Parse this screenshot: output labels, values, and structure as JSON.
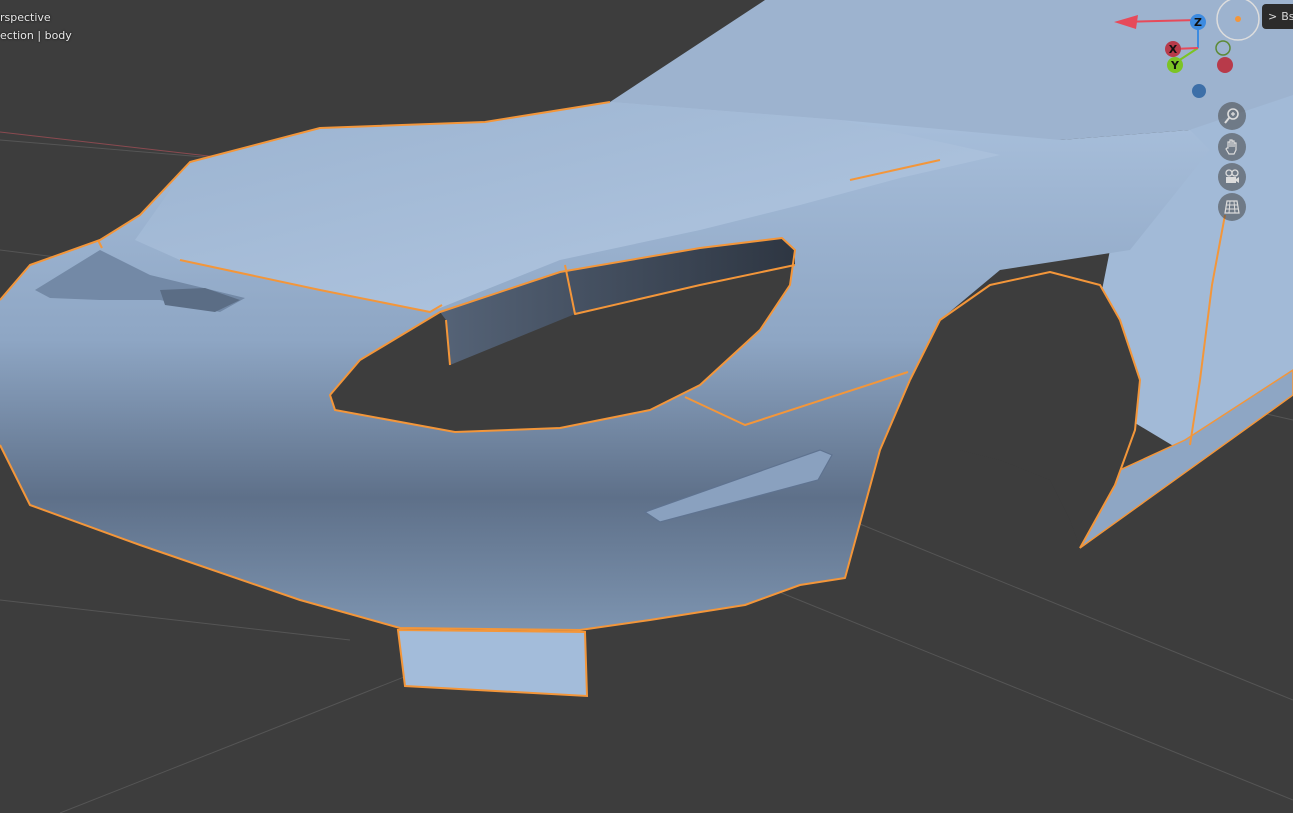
{
  "viewport": {
    "view_mode": "rspective",
    "collection_info": "ection | body",
    "background_color": "#3d3d3d",
    "selection_outline_color": "#f3963a",
    "mesh_color": "#9fb7d6"
  },
  "gizmo": {
    "x_label": "X",
    "y_label": "Y",
    "z_label": "Z",
    "x_color": "#e74a5a",
    "y_color": "#7cc424",
    "z_color": "#3d8be0"
  },
  "nav_buttons": [
    {
      "name": "zoom-icon"
    },
    {
      "name": "hand-pan-icon"
    },
    {
      "name": "camera-icon"
    },
    {
      "name": "perspective-grid-icon"
    }
  ],
  "sidebar_tab": {
    "arrow": ">",
    "label": "Bs"
  }
}
